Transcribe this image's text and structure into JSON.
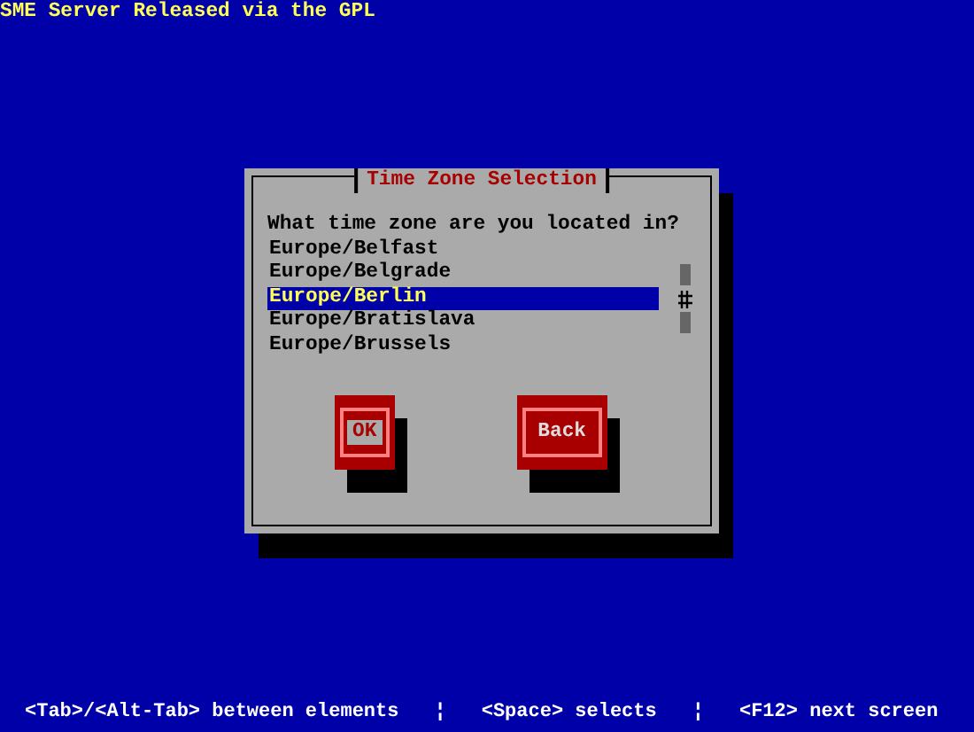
{
  "header": {
    "title": "SME Server Released via the GPL"
  },
  "dialog": {
    "title": "Time Zone Selection",
    "prompt": "What time zone are you located in?",
    "options": [
      {
        "label": "Europe/Belfast",
        "selected": false
      },
      {
        "label": "Europe/Belgrade",
        "selected": false
      },
      {
        "label": "Europe/Berlin",
        "selected": true
      },
      {
        "label": "Europe/Bratislava",
        "selected": false
      },
      {
        "label": "Europe/Brussels",
        "selected": false
      }
    ],
    "buttons": [
      {
        "label": "OK",
        "focused": true
      },
      {
        "label": "Back",
        "focused": false
      }
    ]
  },
  "status_bar": {
    "hints": [
      "<Tab>/<Alt-Tab> between elements",
      "<Space> selects",
      "<F12> next screen"
    ],
    "separator": "¦"
  }
}
